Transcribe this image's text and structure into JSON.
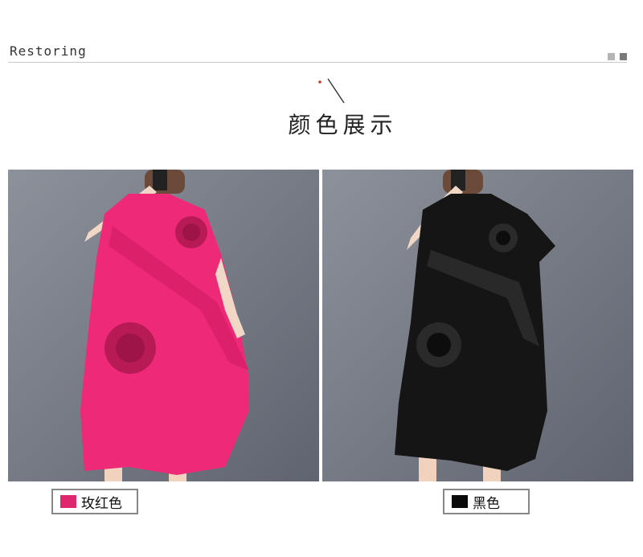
{
  "header": {
    "brand": "Restoring",
    "section_title": "颜色展示"
  },
  "colors": [
    {
      "label": "玫红色",
      "swatch": "#e0266d",
      "dress": "#ee2a78"
    },
    {
      "label": "黑色",
      "swatch": "#0a0a0a",
      "dress": "#151515"
    }
  ],
  "photo_bg": "#6f7480"
}
